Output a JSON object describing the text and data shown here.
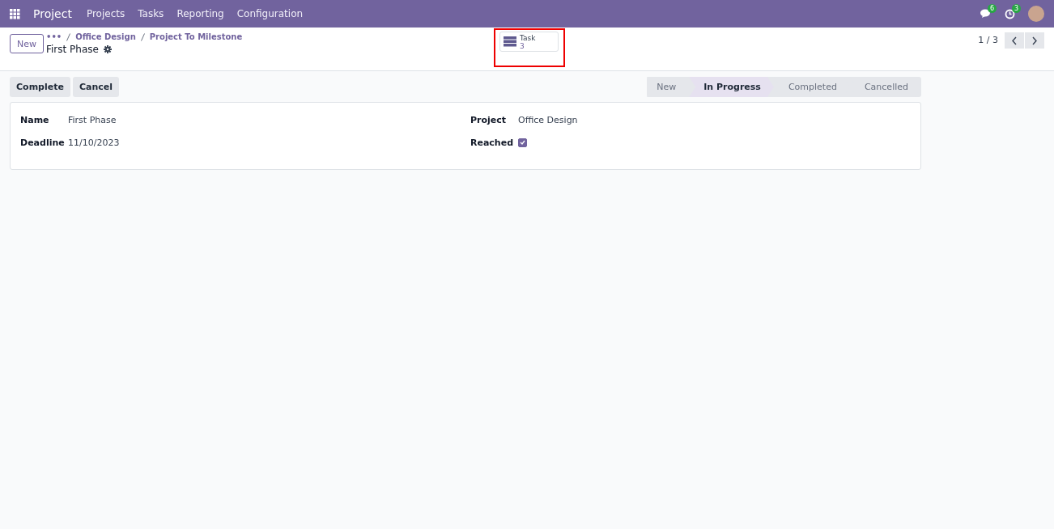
{
  "navbar": {
    "app": "Project",
    "menu": [
      "Projects",
      "Tasks",
      "Reporting",
      "Configuration"
    ],
    "messages_badge": "6",
    "activities_badge": "3"
  },
  "control_panel": {
    "new_button": "New",
    "breadcrumbs": [
      "•••",
      "Office Design",
      "Project To Milestone"
    ],
    "record_title": "First Phase",
    "smart_button": {
      "label": "Task",
      "count": "3"
    },
    "pager": "1 / 3"
  },
  "actions": [
    "Complete",
    "Cancel"
  ],
  "stages": [
    {
      "label": "New",
      "selected": false
    },
    {
      "label": "In Progress",
      "selected": true
    },
    {
      "label": "Completed",
      "selected": false
    },
    {
      "label": "Cancelled",
      "selected": false
    }
  ],
  "fields_left": [
    {
      "label": "Name",
      "value": "First Phase"
    },
    {
      "label": "Deadline",
      "value": "11/10/2023"
    }
  ],
  "fields_right": [
    {
      "label": "Project",
      "kind": "text",
      "value": "Office Design"
    },
    {
      "label": "Reached",
      "kind": "checkbox",
      "checked": true
    }
  ]
}
